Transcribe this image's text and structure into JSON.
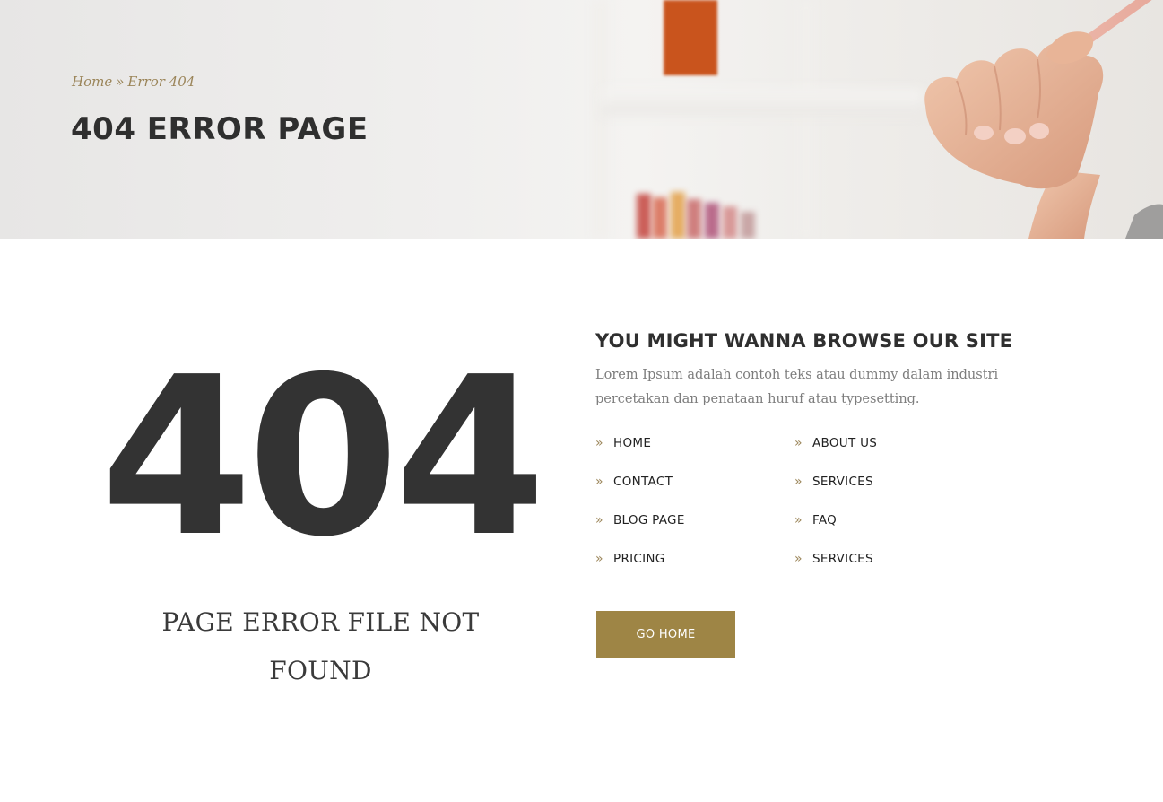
{
  "header": {
    "breadcrumb": {
      "home": "Home",
      "separator": "»",
      "current": "Error 404"
    },
    "title": "404 ERROR PAGE",
    "image_semantics": [
      "bookshelf-background",
      "orange-box",
      "books",
      "hand-holding-pencil"
    ]
  },
  "error": {
    "code": "404",
    "message": "PAGE ERROR FILE NOT FOUND"
  },
  "browse": {
    "title": "YOU MIGHT WANNA BROWSE OUR SITE",
    "description": "Lorem Ipsum adalah contoh teks atau dummy dalam industri percetakan dan penataan huruf atau typesetting.",
    "links": [
      {
        "label": "HOME",
        "icon": "double-chevron-right-icon"
      },
      {
        "label": "ABOUT US",
        "icon": "double-chevron-right-icon"
      },
      {
        "label": "CONTACT",
        "icon": "double-chevron-right-icon"
      },
      {
        "label": "SERVICES",
        "icon": "double-chevron-right-icon"
      },
      {
        "label": "BLOG PAGE",
        "icon": "double-chevron-right-icon"
      },
      {
        "label": "FAQ",
        "icon": "double-chevron-right-icon"
      },
      {
        "label": "PRICING",
        "icon": "double-chevron-right-icon"
      },
      {
        "label": "SERVICES",
        "icon": "double-chevron-right-icon"
      }
    ],
    "button_label": "GO HOME"
  },
  "colors": {
    "accent": "#9e8545",
    "breadcrumb": "#9b8559",
    "heading": "#2f2f2f",
    "body_text": "#7d7d7d",
    "big_number": "#333333"
  }
}
